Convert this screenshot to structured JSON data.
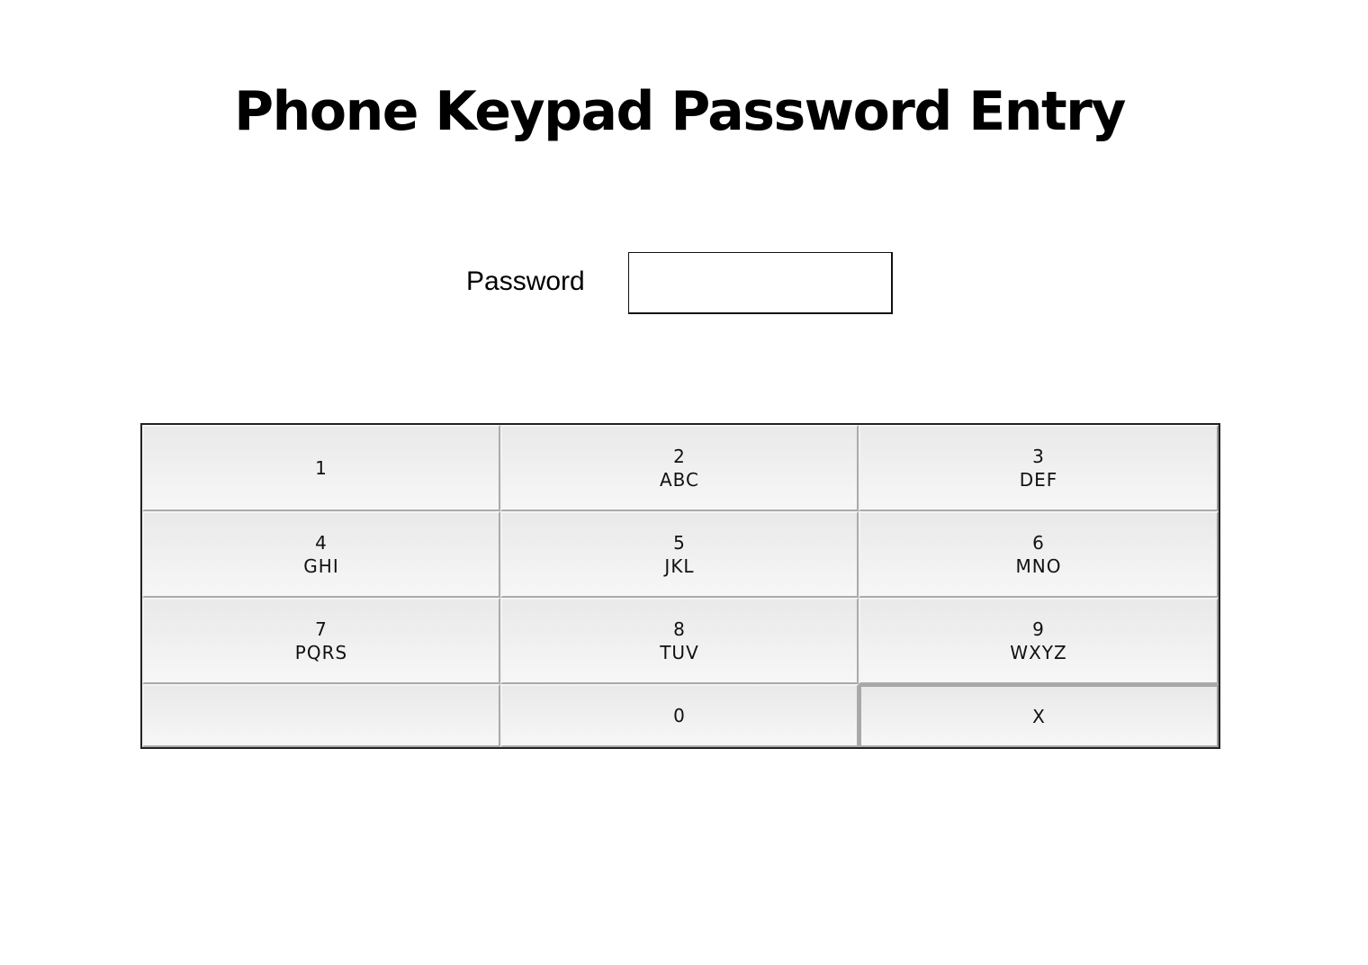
{
  "title": "Phone Keypad Password Entry",
  "password": {
    "label": "Password",
    "value": ""
  },
  "keypad": {
    "keys": [
      {
        "digit": "1",
        "letters": ""
      },
      {
        "digit": "2",
        "letters": "ABC"
      },
      {
        "digit": "3",
        "letters": "DEF"
      },
      {
        "digit": "4",
        "letters": "GHI"
      },
      {
        "digit": "5",
        "letters": "JKL"
      },
      {
        "digit": "6",
        "letters": "MNO"
      },
      {
        "digit": "7",
        "letters": "PQRS"
      },
      {
        "digit": "8",
        "letters": "TUV"
      },
      {
        "digit": "9",
        "letters": "WXYZ"
      },
      {
        "digit": "",
        "letters": ""
      },
      {
        "digit": "0",
        "letters": ""
      },
      {
        "digit": "X",
        "letters": ""
      }
    ]
  }
}
